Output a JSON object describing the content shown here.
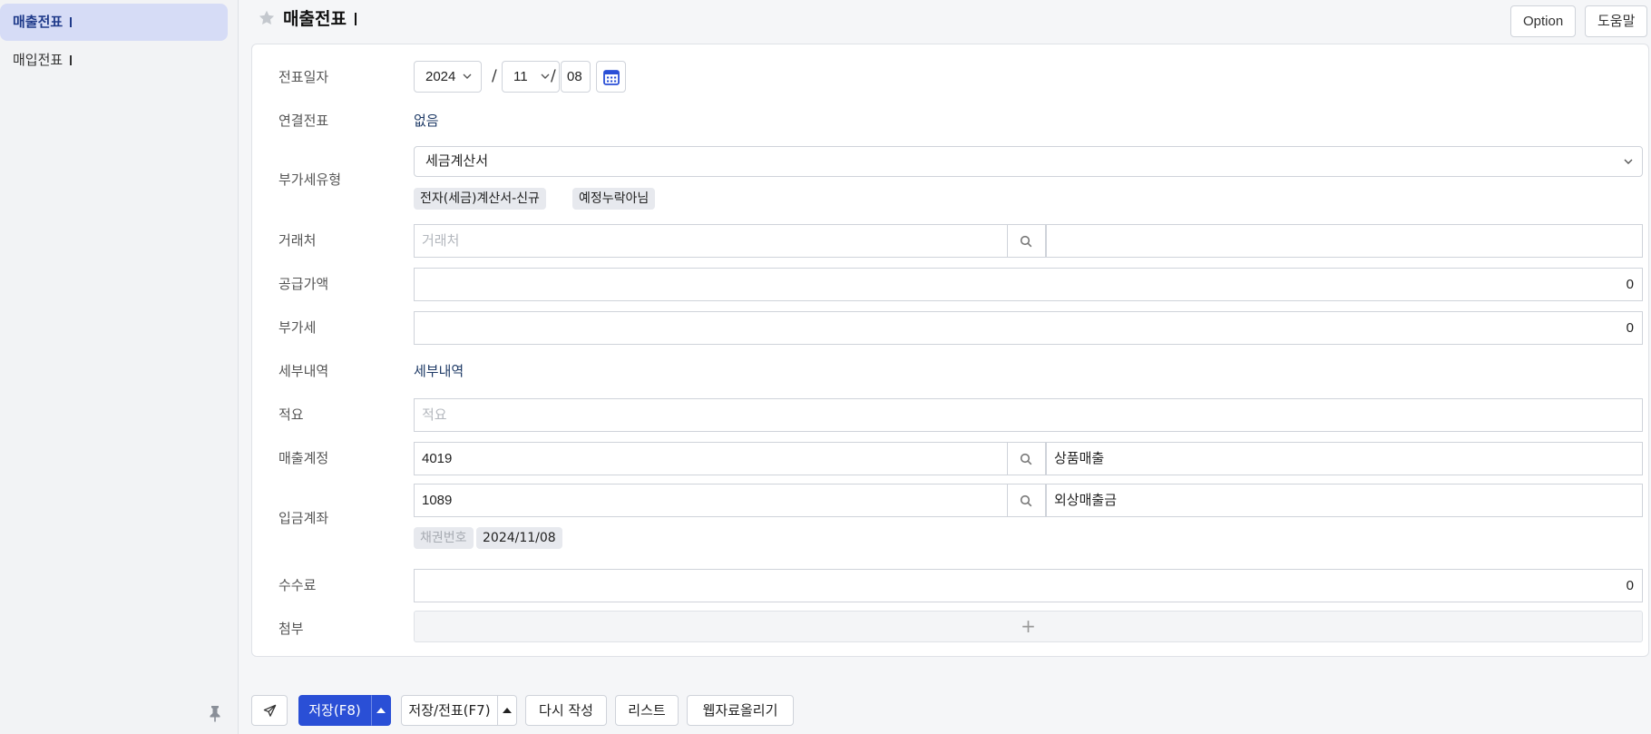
{
  "sidebar": {
    "items": [
      {
        "label": "매출전표",
        "active": true
      },
      {
        "label": "매입전표",
        "active": false
      }
    ]
  },
  "header": {
    "title": "매출전표",
    "option_label": "Option",
    "help_label": "도움말"
  },
  "form": {
    "date": {
      "label": "전표일자",
      "year": "2024",
      "month": "11",
      "day": "08",
      "sep": "/"
    },
    "linked": {
      "label": "연결전표",
      "value": "없음"
    },
    "vat_type": {
      "label": "부가세유형",
      "value": "세금계산서",
      "tags": [
        "전자(세금)계산서-신규",
        "예정누락아님"
      ]
    },
    "client": {
      "label": "거래처",
      "placeholder": "거래처",
      "name": ""
    },
    "supply": {
      "label": "공급가액",
      "value": "0"
    },
    "vat": {
      "label": "부가세",
      "value": "0"
    },
    "details": {
      "label": "세부내역",
      "value": "세부내역"
    },
    "memo": {
      "label": "적요",
      "placeholder": "적요"
    },
    "sales_account": {
      "label": "매출계정",
      "code": "4019",
      "name": "상품매출"
    },
    "deposit_account": {
      "label": "입금계좌",
      "code": "1089",
      "name": "외상매출금",
      "bond_label": "채권번호",
      "bond_date": "2024/11/08"
    },
    "fee": {
      "label": "수수료",
      "value": "0"
    },
    "attach": {
      "label": "첨부",
      "plus": "+"
    }
  },
  "footer": {
    "save_label": "저장(F8)",
    "save_voucher_label": "저장/전표(F7)",
    "rewrite_label": "다시 작성",
    "list_label": "리스트",
    "upload_label": "웹자료올리기"
  },
  "colors": {
    "accent": "#2a4fd6",
    "sidebar_active": "#d6dcf6",
    "calendar_icon": "#2a4fd6"
  }
}
